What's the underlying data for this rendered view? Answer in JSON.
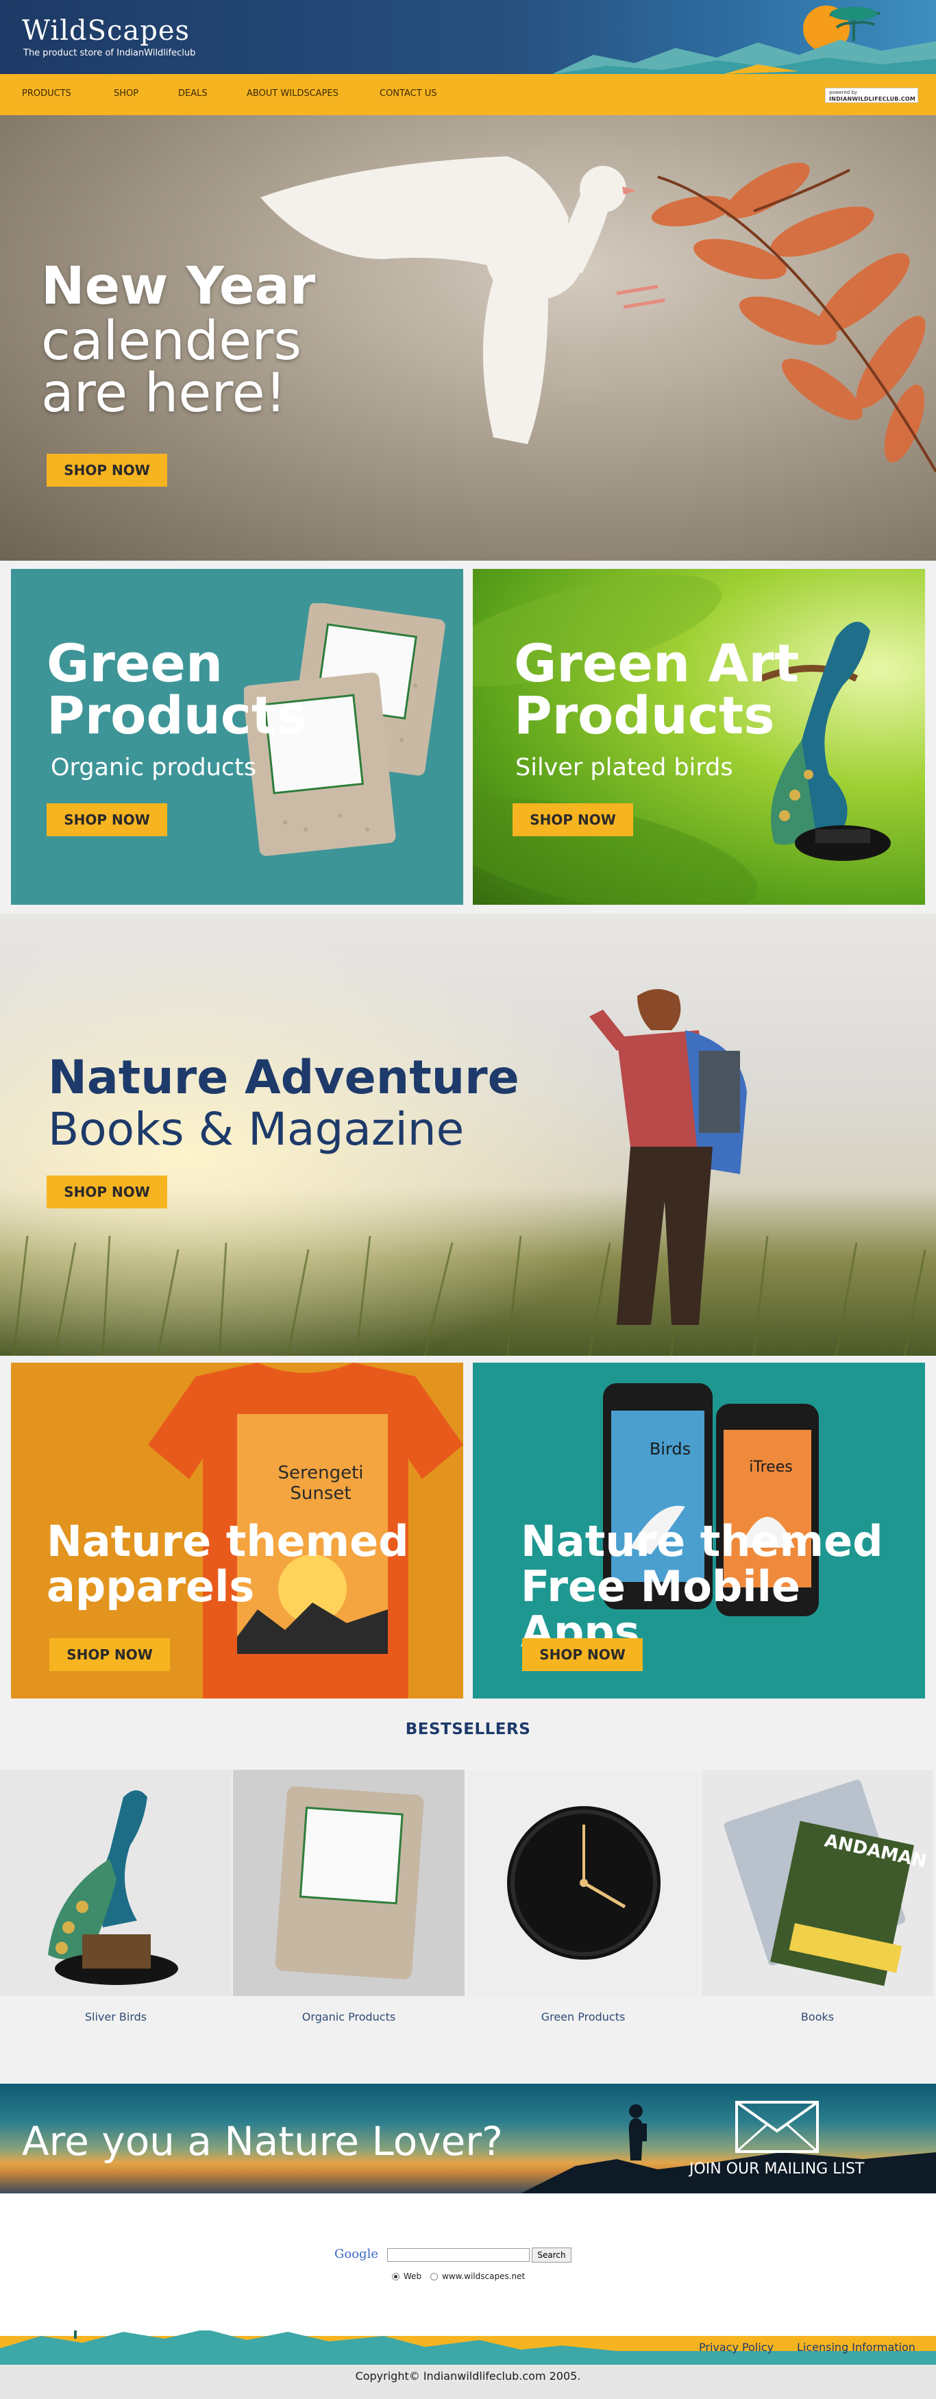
{
  "header": {
    "logo": "WildScapes",
    "tagline": "The product store of IndianWildlifeclub"
  },
  "nav": {
    "items": [
      "PRODUCTS",
      "SHOP",
      "DEALS",
      "ABOUT WILDSCAPES",
      "CONTACT US"
    ],
    "powered_by_small": "powered by",
    "powered_by_brand": "INDIANWILDLIFECLUB.COM"
  },
  "hero": {
    "line1": "New Year",
    "line2": "calenders",
    "line3": "are here!",
    "button": "SHOP NOW"
  },
  "promos": {
    "green_products": {
      "title1": "Green",
      "title2": "Products",
      "sub": "Organic products",
      "button": "SHOP NOW"
    },
    "green_art": {
      "title1": "Green Art",
      "title2": "Products",
      "sub": "Silver plated birds",
      "button": "SHOP NOW"
    },
    "apparels": {
      "title1": "Nature themed",
      "title2": "apparels",
      "shirt_text": "Serengeti Sunset",
      "button": "SHOP NOW"
    },
    "apps": {
      "title1": "Nature themed",
      "title2": "Free Mobile Apps",
      "phone1_title": "Birds",
      "phone2_title": "iTrees",
      "button": "SHOP NOW"
    }
  },
  "adventure": {
    "title1": "Nature Adventure",
    "title2": "Books & Magazine",
    "button": "SHOP NOW"
  },
  "bestsellers": {
    "heading": "BESTSELLERS",
    "items": [
      {
        "label": "Sliver Birds"
      },
      {
        "label": "Organic Products"
      },
      {
        "label": "Green Products"
      },
      {
        "label": "Books"
      }
    ],
    "book_title": "ANDAMAN"
  },
  "newsletter": {
    "title": "Are you a Nature Lover?",
    "join": "JOIN OUR MAILING LIST"
  },
  "search": {
    "logo": "Google",
    "button": "Search",
    "option_web": "Web",
    "option_site": "www.wildscapes.net"
  },
  "footer": {
    "privacy": "Privacy Policy",
    "licensing": "Licensing Information",
    "copyright": "Copyright© Indianwildlifeclub.com 2005."
  },
  "colors": {
    "accent": "#f7b421",
    "navy": "#1d3a6a",
    "teal": "#3e9598",
    "orange": "#e3941e"
  }
}
